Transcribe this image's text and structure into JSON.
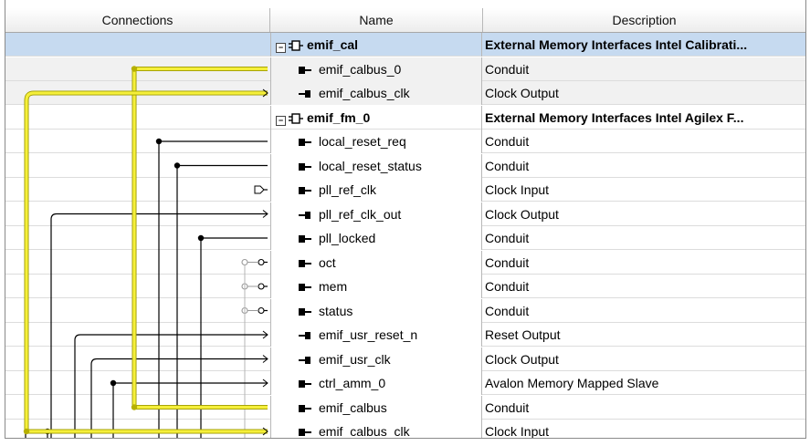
{
  "header": {
    "connections": "Connections",
    "name": "Name",
    "description": "Description"
  },
  "rows": [
    {
      "name": "emif_cal",
      "desc": "External Memory Interfaces Intel Calibrati...",
      "kind": "group"
    },
    {
      "name": "emif_calbus_0",
      "desc": "Conduit",
      "kind": "port",
      "dir": "in"
    },
    {
      "name": "emif_calbus_clk",
      "desc": "Clock Output",
      "kind": "port",
      "dir": "out"
    },
    {
      "name": "emif_fm_0",
      "desc": "External Memory Interfaces Intel Agilex F...",
      "kind": "group"
    },
    {
      "name": "local_reset_req",
      "desc": "Conduit",
      "kind": "port",
      "dir": "in"
    },
    {
      "name": "local_reset_status",
      "desc": "Conduit",
      "kind": "port",
      "dir": "in"
    },
    {
      "name": "pll_ref_clk",
      "desc": "Clock Input",
      "kind": "port",
      "dir": "in"
    },
    {
      "name": "pll_ref_clk_out",
      "desc": "Clock Output",
      "kind": "port",
      "dir": "out"
    },
    {
      "name": "pll_locked",
      "desc": "Conduit",
      "kind": "port",
      "dir": "in"
    },
    {
      "name": "oct",
      "desc": "Conduit",
      "kind": "port",
      "dir": "in"
    },
    {
      "name": "mem",
      "desc": "Conduit",
      "kind": "port",
      "dir": "in"
    },
    {
      "name": "status",
      "desc": "Conduit",
      "kind": "port",
      "dir": "in"
    },
    {
      "name": "emif_usr_reset_n",
      "desc": "Reset Output",
      "kind": "port",
      "dir": "out"
    },
    {
      "name": "emif_usr_clk",
      "desc": "Clock Output",
      "kind": "port",
      "dir": "out"
    },
    {
      "name": "ctrl_amm_0",
      "desc": "Avalon Memory Mapped Slave",
      "kind": "port",
      "dir": "in"
    },
    {
      "name": "emif_calbus",
      "desc": "Conduit",
      "kind": "port",
      "dir": "in"
    },
    {
      "name": "emif_calbus_clk",
      "desc": "Clock Input",
      "kind": "port",
      "dir": "in"
    }
  ],
  "colors": {
    "selected_row": "#c6daf0",
    "highlight_wire": "#f5ef3a",
    "highlight_wire_edge": "#9c9a00",
    "wire": "#000000"
  }
}
